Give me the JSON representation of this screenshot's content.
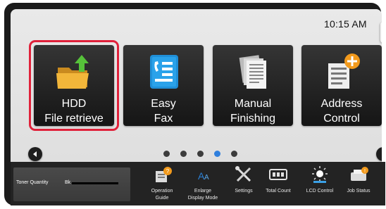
{
  "status": {
    "time": "10:15 AM",
    "side_tab_glyph": "◂"
  },
  "tiles": [
    {
      "label": "HDD\nFile retrieve",
      "icon": "folder-retrieve-icon"
    },
    {
      "label": "Easy\nFax",
      "icon": "fax-phonebook-icon"
    },
    {
      "label": "Manual\nFinishing",
      "icon": "document-stack-icon"
    },
    {
      "label": "Address\nControl",
      "icon": "add-address-icon"
    }
  ],
  "highlight_color": "#e0213a",
  "pager": {
    "page_count": 5,
    "active_index": 3,
    "active_color": "#2f7fdd"
  },
  "toner": {
    "label": "Toner Quantity",
    "channel": "Bk",
    "level_fraction": 1.0
  },
  "bottom_bar": [
    {
      "label": "Operation\nGuide",
      "icon": "operation-guide-icon"
    },
    {
      "label": "Enlarge\nDisplay Mode",
      "icon": "enlarge-display-icon"
    },
    {
      "label": "Settings",
      "icon": "settings-tools-icon"
    },
    {
      "label": "Total Count",
      "icon": "counter-icon"
    },
    {
      "label": "LCD Control",
      "icon": "brightness-icon"
    },
    {
      "label": "Job Status",
      "icon": "job-status-icon"
    }
  ]
}
